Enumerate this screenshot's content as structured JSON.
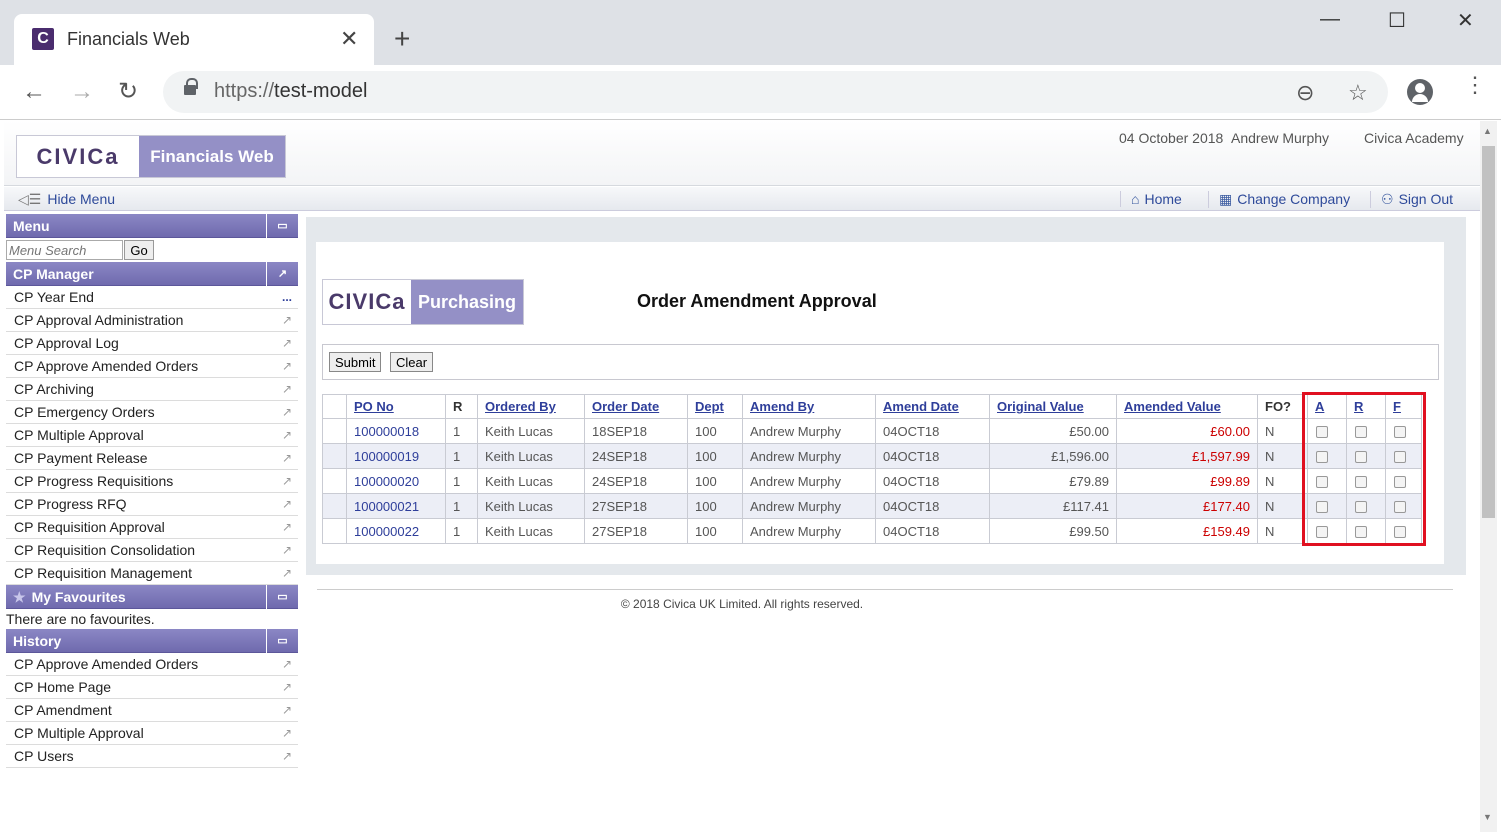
{
  "browser": {
    "tab_title": "Financials Web",
    "tab_favicon": "C",
    "close_glyph": "✕",
    "newtab_glyph": "+",
    "url_scheme": "https://",
    "url_host": "test-model",
    "minimize_glyph": "—",
    "maximize_glyph": "☐",
    "windowclose_glyph": "✕",
    "back_glyph": "←",
    "forward_glyph": "→",
    "reload_glyph": "↻",
    "zoom_glyph": "⊖",
    "star_glyph": "☆",
    "kebab_glyph": "⋮"
  },
  "header": {
    "logo_civica": "CIVICa",
    "logo_product": "Financials Web",
    "date": "04 October 2018",
    "user": "Andrew Murphy",
    "organisation": "Civica Academy"
  },
  "menubar": {
    "hide_menu": "Hide Menu",
    "home": "Home",
    "change_company": "Change Company",
    "sign_out": "Sign Out"
  },
  "sidebar": {
    "menu_title": "Menu",
    "search_placeholder": "Menu Search",
    "search_go": "Go",
    "cp_manager_title": "CP Manager",
    "cp_items": [
      "CP Year End",
      "CP Approval Administration",
      "CP Approval Log",
      "CP Approve Amended Orders",
      "CP Archiving",
      "CP Emergency Orders",
      "CP Multiple Approval",
      "CP Payment Release",
      "CP Progress Requisitions",
      "CP Progress RFQ",
      "CP Requisition Approval",
      "CP Requisition Consolidation",
      "CP Requisition Management"
    ],
    "favourites_title": "My Favourites",
    "favourites_note": "There are no favourites.",
    "history_title": "History",
    "history_items": [
      "CP Approve Amended Orders",
      "CP Home Page",
      "CP Amendment",
      "CP Multiple Approval",
      "CP Users"
    ]
  },
  "main": {
    "logo_civica": "CIVICa",
    "logo_module": "Purchasing",
    "title": "Order Amendment Approval",
    "submit": "Submit",
    "clear": "Clear",
    "columns": [
      "PO No",
      "R",
      "Ordered By",
      "Order Date",
      "Dept",
      "Amend By",
      "Amend Date",
      "Original Value",
      "Amended Value",
      "FO?",
      "A",
      "R",
      "F"
    ],
    "rows": [
      {
        "po": "100000018",
        "r": "1",
        "ordered_by": "Keith Lucas",
        "order_date": "18SEP18",
        "dept": "100",
        "amend_by": "Andrew Murphy",
        "amend_date": "04OCT18",
        "original": "£50.00",
        "amended": "£60.00",
        "fo": "N"
      },
      {
        "po": "100000019",
        "r": "1",
        "ordered_by": "Keith Lucas",
        "order_date": "24SEP18",
        "dept": "100",
        "amend_by": "Andrew Murphy",
        "amend_date": "04OCT18",
        "original": "£1,596.00",
        "amended": "£1,597.99",
        "fo": "N"
      },
      {
        "po": "100000020",
        "r": "1",
        "ordered_by": "Keith Lucas",
        "order_date": "24SEP18",
        "dept": "100",
        "amend_by": "Andrew Murphy",
        "amend_date": "04OCT18",
        "original": "£79.89",
        "amended": "£99.89",
        "fo": "N"
      },
      {
        "po": "100000021",
        "r": "1",
        "ordered_by": "Keith Lucas",
        "order_date": "27SEP18",
        "dept": "100",
        "amend_by": "Andrew Murphy",
        "amend_date": "04OCT18",
        "original": "£117.41",
        "amended": "£177.40",
        "fo": "N"
      },
      {
        "po": "100000022",
        "r": "1",
        "ordered_by": "Keith Lucas",
        "order_date": "27SEP18",
        "dept": "100",
        "amend_by": "Andrew Murphy",
        "amend_date": "04OCT18",
        "original": "£99.50",
        "amended": "£159.49",
        "fo": "N"
      }
    ]
  },
  "footer": {
    "copyright": "© 2018 Civica UK Limited. All rights reserved."
  },
  "colors": {
    "accent_purple": "#9490c6",
    "link_blue": "#2e3e9a",
    "amended_red": "#cc0000",
    "highlight_red": "#e01020"
  }
}
